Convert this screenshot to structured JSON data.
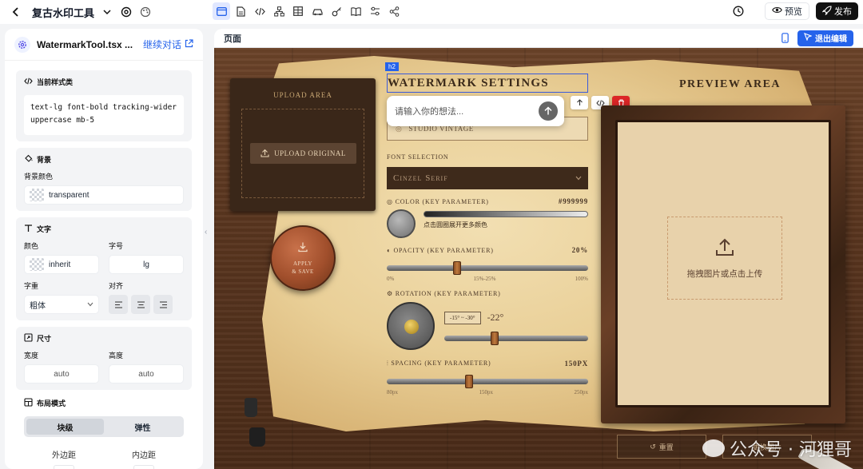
{
  "app": {
    "title": "复古水印工具"
  },
  "toolbar_right": {
    "preview_label": "预览",
    "publish_label": "发布"
  },
  "file": {
    "name": "WatermarkTool.tsx ...",
    "continue_label": "继续对话"
  },
  "style_class": {
    "title": "当前样式类",
    "value_line1": "text-lg font-bold tracking-wider",
    "value_line2": "uppercase mb-5"
  },
  "background": {
    "title": "背景",
    "color_label": "背景颜色",
    "color_value": "transparent"
  },
  "text": {
    "title": "文字",
    "color_label": "颜色",
    "color_value": "inherit",
    "size_label": "字号",
    "size_value": "lg",
    "weight_label": "字重",
    "weight_value": "粗体",
    "align_label": "对齐"
  },
  "size": {
    "title": "尺寸",
    "width_label": "宽度",
    "width_value": "auto",
    "height_label": "高度",
    "height_value": "auto"
  },
  "layout": {
    "title": "布局模式",
    "option_block": "块级",
    "option_flex": "弹性",
    "active": "块级",
    "margin_label": "外边距",
    "padding_label": "内边距",
    "margin_value": "-",
    "padding_value": "-"
  },
  "page_header": {
    "title": "页面",
    "exit_label": "退出编辑"
  },
  "canvas": {
    "upload_area_title": "UPLOAD AREA",
    "upload_button": "UPLOAD ORIGINAL",
    "apply_line1": "APPLY",
    "apply_line2": "& SAVE",
    "element_tag": "h2",
    "settings_title": "WATERMARK SETTINGS",
    "chat_placeholder": "请输入你的想法...",
    "text_input_value": "STUDIO VINTAGE",
    "font_label": "FONT SELECTION",
    "font_value": "Cinzel Serif",
    "color_label": "COLOR",
    "color_key": "(KEY PARAMETER)",
    "color_value": "#999999",
    "color_hint": "点击圆圈展开更多颜色",
    "opacity_label": "OPACITY",
    "opacity_key": "(KEY PARAMETER)",
    "opacity_value": "20%",
    "opacity_level": 0.35,
    "opacity_ticks": [
      "0%",
      "15%-25%",
      "100%"
    ],
    "rotation_label": "ROTATION",
    "rotation_key": "(KEY PARAMETER)",
    "rotation_range": "-15° ~ -30°",
    "rotation_value": "-22°",
    "rotation_level": 0.35,
    "spacing_label": "SPACING",
    "spacing_key": "(KEY PARAMETER)",
    "spacing_value": "150PX",
    "spacing_level": 0.41,
    "spacing_ticks": [
      "80px",
      "150px",
      "250px"
    ],
    "preview_title": "PREVIEW AREA",
    "drop_text": "拖拽图片或点击上传",
    "reset_label": "重置",
    "replace_label": "更换图片"
  },
  "watermark": {
    "text": "公众号 · 河狸哥"
  }
}
